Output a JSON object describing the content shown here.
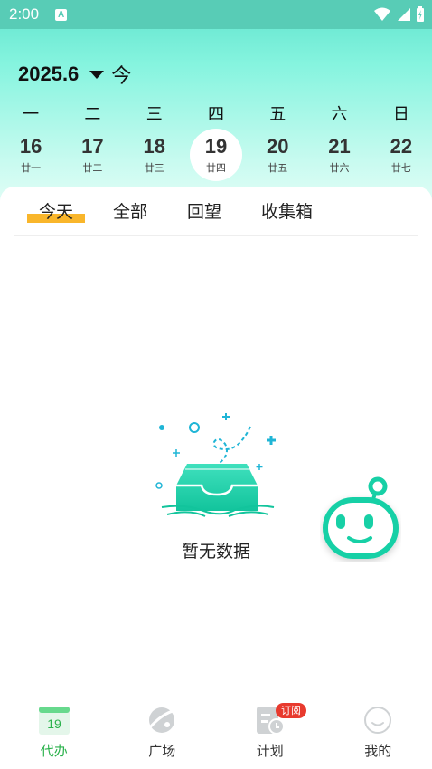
{
  "status_bar": {
    "time": "2:00",
    "notification_badge": "A"
  },
  "calendar": {
    "month": "2025.6",
    "today_button": "今",
    "weekdays": [
      "一",
      "二",
      "三",
      "四",
      "五",
      "六",
      "日"
    ],
    "dates": [
      {
        "day": "16",
        "lunar": "廿一"
      },
      {
        "day": "17",
        "lunar": "廿二"
      },
      {
        "day": "18",
        "lunar": "廿三"
      },
      {
        "day": "19",
        "lunar": "廿四"
      },
      {
        "day": "20",
        "lunar": "廿五"
      },
      {
        "day": "21",
        "lunar": "廿六"
      },
      {
        "day": "22",
        "lunar": "廿七"
      }
    ],
    "selected_index": 3
  },
  "tabs": [
    {
      "label": "今天",
      "active": true
    },
    {
      "label": "全部",
      "active": false
    },
    {
      "label": "回望",
      "active": false
    },
    {
      "label": "收集箱",
      "active": false
    }
  ],
  "empty_state": {
    "text": "暂无数据"
  },
  "bottom_nav": {
    "items": [
      {
        "label": "代办",
        "icon": "calendar-icon",
        "icon_text": "19",
        "active": true
      },
      {
        "label": "广场",
        "icon": "planet-icon",
        "active": false
      },
      {
        "label": "计划",
        "icon": "plan-icon",
        "badge": "订阅",
        "active": false
      },
      {
        "label": "我的",
        "icon": "smile-icon",
        "active": false
      }
    ]
  },
  "colors": {
    "accent": "#2bb24c",
    "teal": "#17d0a6",
    "tab_highlight": "#f9b62b",
    "badge": "#e83a2e"
  }
}
